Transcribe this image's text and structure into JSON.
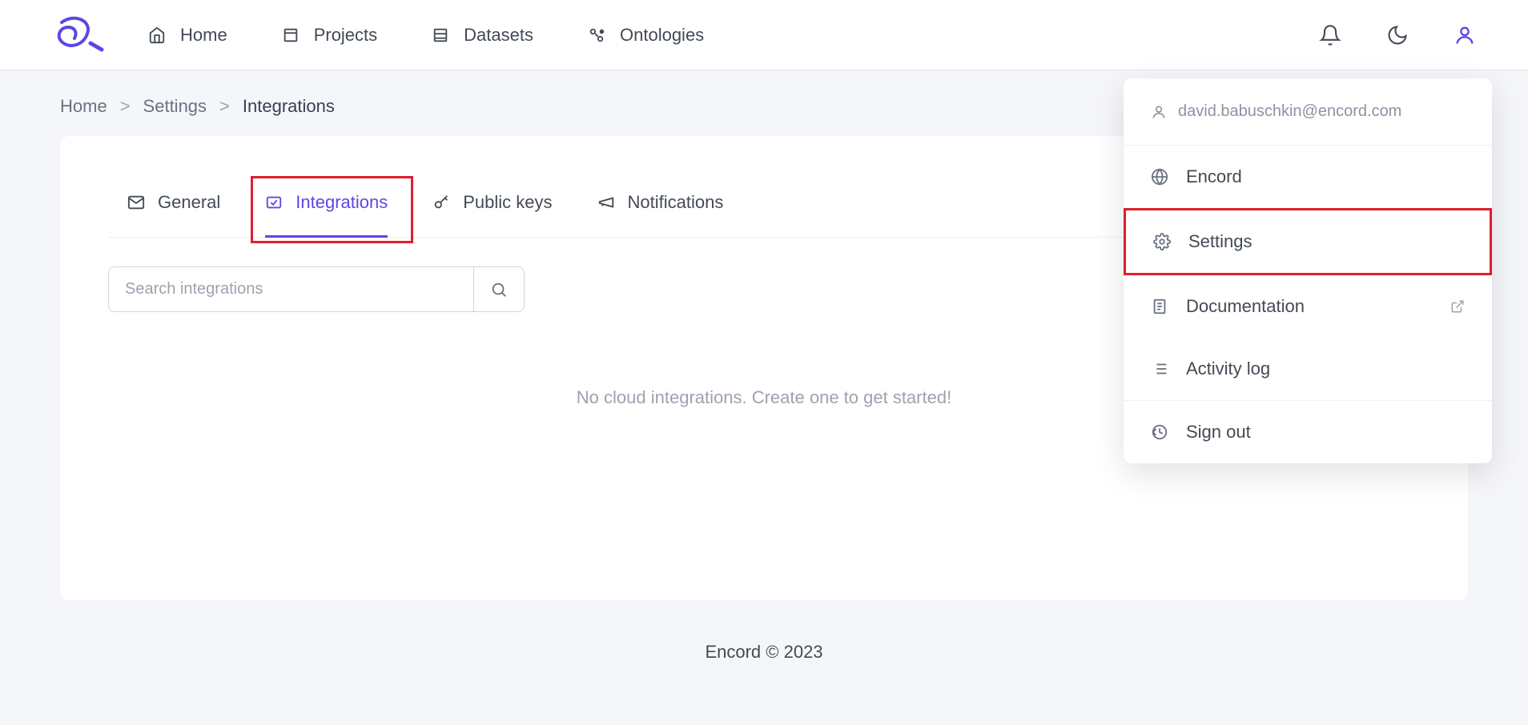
{
  "nav": {
    "home": "Home",
    "projects": "Projects",
    "datasets": "Datasets",
    "ontologies": "Ontologies"
  },
  "breadcrumb": {
    "items": [
      "Home",
      "Settings",
      "Integrations"
    ]
  },
  "tabs": {
    "general": "General",
    "integrations": "Integrations",
    "public_keys": "Public keys",
    "notifications": "Notifications"
  },
  "search": {
    "placeholder": "Search integrations"
  },
  "empty_state": "No cloud integrations. Create one to get started!",
  "footer": "Encord © 2023",
  "dropdown": {
    "email": "david.babuschkin@encord.com",
    "encord": "Encord",
    "settings": "Settings",
    "documentation": "Documentation",
    "activity_log": "Activity log",
    "sign_out": "Sign out"
  }
}
